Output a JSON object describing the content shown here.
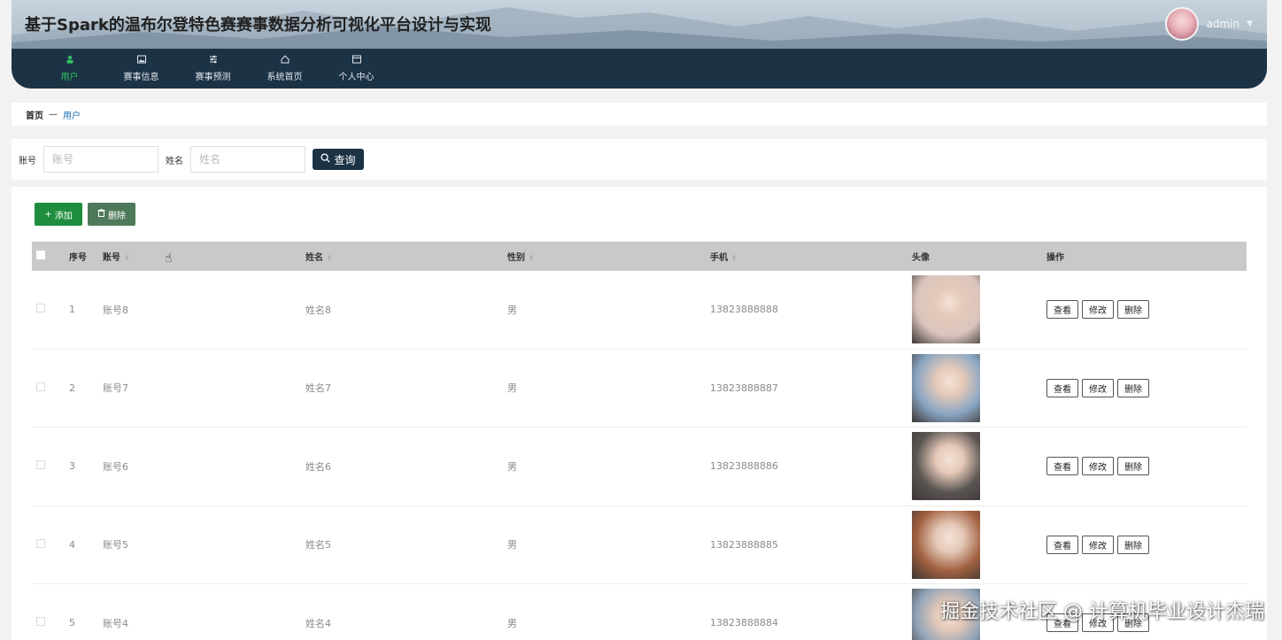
{
  "header": {
    "title": "基于Spark的温布尔登特色赛赛事数据分析可视化平台设计与实现",
    "username": "admin"
  },
  "nav": [
    {
      "label": "用户",
      "icon": "user-icon",
      "active": true
    },
    {
      "label": "赛事信息",
      "icon": "image-icon",
      "active": false
    },
    {
      "label": "赛事预测",
      "icon": "sliders-icon",
      "active": false
    },
    {
      "label": "系统首页",
      "icon": "home-icon",
      "active": false
    },
    {
      "label": "个人中心",
      "icon": "window-icon",
      "active": false
    }
  ],
  "breadcrumb": {
    "home": "首页",
    "separator": "—",
    "current": "用户"
  },
  "search": {
    "account_label": "账号",
    "account_placeholder": "账号",
    "name_label": "姓名",
    "name_placeholder": "姓名",
    "query_label": "查询"
  },
  "actions": {
    "add_label": "添加",
    "delete_label": "删除"
  },
  "table": {
    "headers": {
      "index": "序号",
      "account": "账号",
      "name": "姓名",
      "gender": "性别",
      "phone": "手机",
      "avatar": "头像",
      "operation": "操作"
    },
    "rows": [
      {
        "index": "1",
        "account": "账号8",
        "name": "姓名8",
        "gender": "男",
        "phone": "13823888888",
        "photo_color": "#d9c4bd"
      },
      {
        "index": "2",
        "account": "账号7",
        "name": "姓名7",
        "gender": "男",
        "phone": "13823888887",
        "photo_color": "#8aa6c4"
      },
      {
        "index": "3",
        "account": "账号6",
        "name": "姓名6",
        "gender": "男",
        "phone": "13823888886",
        "photo_color": "#5a5552"
      },
      {
        "index": "4",
        "account": "账号5",
        "name": "姓名5",
        "gender": "男",
        "phone": "13823888885",
        "photo_color": "#a06040"
      },
      {
        "index": "5",
        "account": "账号4",
        "name": "姓名4",
        "gender": "男",
        "phone": "13823888884",
        "photo_color": "#8fa3b8"
      }
    ],
    "row_buttons": {
      "view": "查看",
      "edit": "修改",
      "delete": "删除"
    }
  },
  "watermark": "掘金技术社区 @ 计算机毕业设计杰瑞",
  "colors": {
    "header_dark": "#1c3346",
    "accent_green": "#2fbf64",
    "add_green": "#1e8e3e"
  }
}
